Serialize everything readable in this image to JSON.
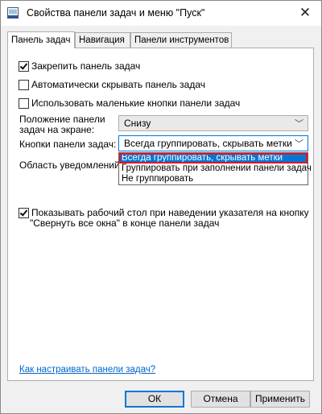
{
  "window": {
    "title": "Свойства панели задач и меню \"Пуск\"",
    "close_glyph": "✕"
  },
  "tabs": [
    {
      "label": "Панель задач",
      "active": true
    },
    {
      "label": "Навигация",
      "active": false
    },
    {
      "label": "Панели инструментов",
      "active": false
    }
  ],
  "options": {
    "lock_taskbar": {
      "label": "Закрепить панель задач",
      "checked": true
    },
    "autohide": {
      "label": "Автоматически скрывать панель задач",
      "checked": false
    },
    "small_buttons": {
      "label": "Использовать маленькие кнопки панели задач",
      "checked": false
    }
  },
  "position": {
    "label_line1": "Положение панели",
    "label_line2": "задач на экране:",
    "value": "Снизу"
  },
  "buttons_group": {
    "label": "Кнопки панели задач:",
    "value": "Всегда группировать, скрывать метки",
    "dropdown_options": [
      "Всегда группировать, скрывать метки",
      "Группировать при заполнении панели задач",
      "Не группировать"
    ]
  },
  "notification_area": {
    "label": "Область уведомлений:"
  },
  "peek": {
    "line1": "Показывать рабочий стол при наведении указателя на кнопку",
    "line2": "\"Свернуть все окна\" в конце панели задач",
    "checked": true
  },
  "help_link": "Как настраивать панели задач?",
  "footer": {
    "ok": "ОК",
    "cancel": "Отмена",
    "apply": "Применить"
  }
}
